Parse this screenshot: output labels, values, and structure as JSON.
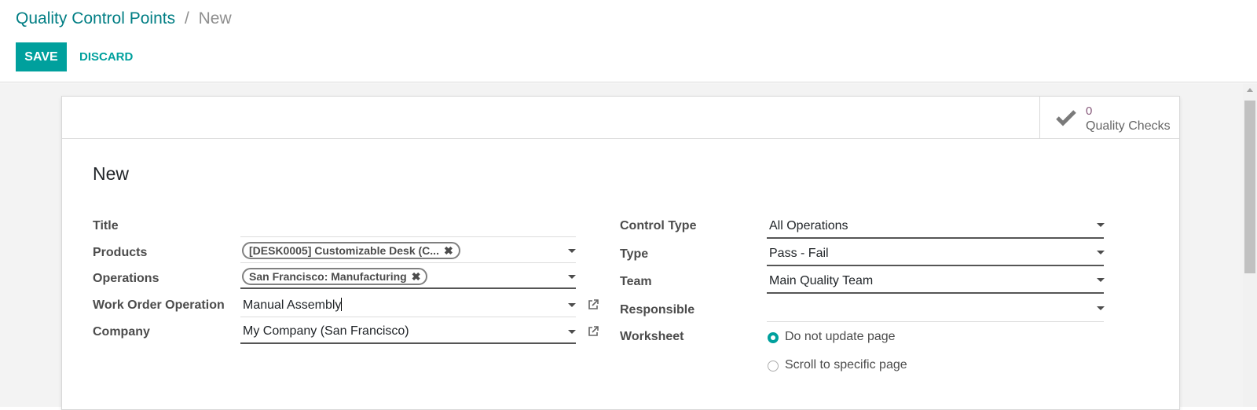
{
  "breadcrumb": {
    "parent": "Quality Control Points",
    "separator": "/",
    "current": "New"
  },
  "toolbar": {
    "save_label": "SAVE",
    "discard_label": "DISCARD"
  },
  "stat_button": {
    "value": "0",
    "label": "Quality Checks",
    "icon": "check-icon"
  },
  "record": {
    "title": "New"
  },
  "left_fields": {
    "title_label": "Title",
    "title_value": "",
    "products_label": "Products",
    "products_tags": [
      "[DESK0005] Customizable Desk (C..."
    ],
    "operations_label": "Operations",
    "operations_tags": [
      "San Francisco: Manufacturing"
    ],
    "work_order_label": "Work Order Operation",
    "work_order_value": "Manual Assembly",
    "company_label": "Company",
    "company_value": "My Company (San Francisco)"
  },
  "right_fields": {
    "control_type_label": "Control Type",
    "control_type_value": "All Operations",
    "type_label": "Type",
    "type_value": "Pass - Fail",
    "team_label": "Team",
    "team_value": "Main Quality Team",
    "responsible_label": "Responsible",
    "responsible_value": "",
    "worksheet_label": "Worksheet",
    "worksheet_options": [
      "Do not update page",
      "Scroll to specific page"
    ],
    "worksheet_selected": "Do not update page"
  },
  "colors": {
    "primary": "#00a09d",
    "link": "#017e84",
    "stat_value": "#875a7b"
  }
}
